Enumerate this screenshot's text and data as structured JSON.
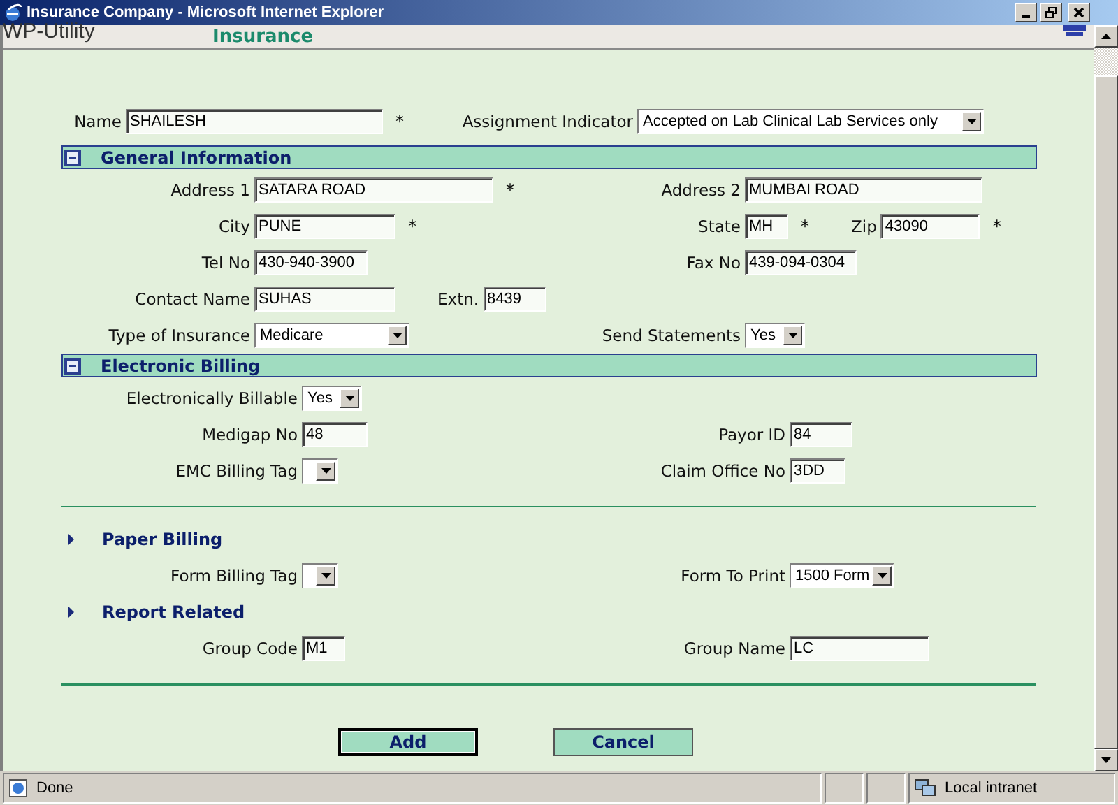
{
  "window": {
    "title": "Insurance Company - Microsoft Internet Explorer"
  },
  "header": {
    "app_name": "WP-Utility",
    "page_title": "Insurance"
  },
  "top_row": {
    "left": [
      {
        "label": "Name",
        "value": "SHAILESH",
        "kind": "text",
        "marker": "*"
      }
    ],
    "right": [
      {
        "label": "Assignment Indicator",
        "value": "Accepted on Lab Clinical Lab Services only",
        "kind": "select"
      }
    ]
  },
  "sections": [
    {
      "title": "General Information",
      "kind": "banner",
      "rows": [
        {
          "left": [
            {
              "label": "Address 1",
              "value": "SATARA ROAD",
              "kind": "text",
              "marker": "*"
            }
          ],
          "right": [
            {
              "label": "Address 2",
              "value": "MUMBAI ROAD",
              "kind": "text"
            }
          ]
        },
        {
          "left": [
            {
              "label": "City",
              "value": "PUNE",
              "kind": "text",
              "marker": "*"
            }
          ],
          "right": [
            {
              "label": "State",
              "value": "MH",
              "kind": "text",
              "marker": "*"
            },
            {
              "label": "Zip",
              "value": "43090",
              "kind": "text",
              "marker": "*"
            }
          ]
        },
        {
          "left": [
            {
              "label": "Tel No",
              "value": "430-940-3900",
              "kind": "text"
            }
          ],
          "right": [
            {
              "label": "Fax No",
              "value": "439-094-0304",
              "kind": "text"
            }
          ]
        },
        {
          "left": [
            {
              "label": "Contact Name",
              "value": "SUHAS",
              "kind": "text"
            },
            {
              "label": "Extn.",
              "value": "8439",
              "kind": "text"
            }
          ],
          "right": []
        },
        {
          "left": [
            {
              "label": "Type of Insurance",
              "value": "Medicare",
              "kind": "select"
            }
          ],
          "right": [
            {
              "label": "Send Statements",
              "value": "Yes",
              "kind": "select"
            }
          ]
        }
      ]
    },
    {
      "title": "Electronic Billing",
      "kind": "banner",
      "rows": [
        {
          "left": [
            {
              "label": "Electronically Billable",
              "value": "Yes",
              "kind": "select"
            }
          ],
          "right": []
        },
        {
          "left": [
            {
              "label": "Medigap No",
              "value": "48",
              "kind": "text"
            }
          ],
          "right": [
            {
              "label": "Payor ID",
              "value": "84",
              "kind": "text"
            }
          ]
        },
        {
          "left": [
            {
              "label": "EMC Billing Tag",
              "kind": "select"
            }
          ],
          "right": [
            {
              "label": "Claim Office No",
              "value": "3DD",
              "kind": "text"
            }
          ]
        }
      ]
    },
    {
      "title": "Paper Billing",
      "kind": "arrow",
      "rows": [
        {
          "left": [
            {
              "label": "Form Billing Tag",
              "kind": "select"
            }
          ],
          "right": [
            {
              "label": "Form To Print",
              "value": "1500 Form",
              "kind": "select"
            }
          ]
        }
      ]
    },
    {
      "title": "Report Related",
      "kind": "arrow",
      "rows": [
        {
          "left": [
            {
              "label": "Group Code",
              "value": "M1",
              "kind": "text"
            }
          ],
          "right": [
            {
              "label": "Group Name",
              "value": "LC",
              "kind": "text"
            }
          ]
        }
      ]
    }
  ],
  "buttons": [
    {
      "label": "Add",
      "focused": true
    },
    {
      "label": "Cancel",
      "focused": false
    }
  ],
  "status_bar": {
    "text": "Done",
    "zone": "Local intranet"
  }
}
